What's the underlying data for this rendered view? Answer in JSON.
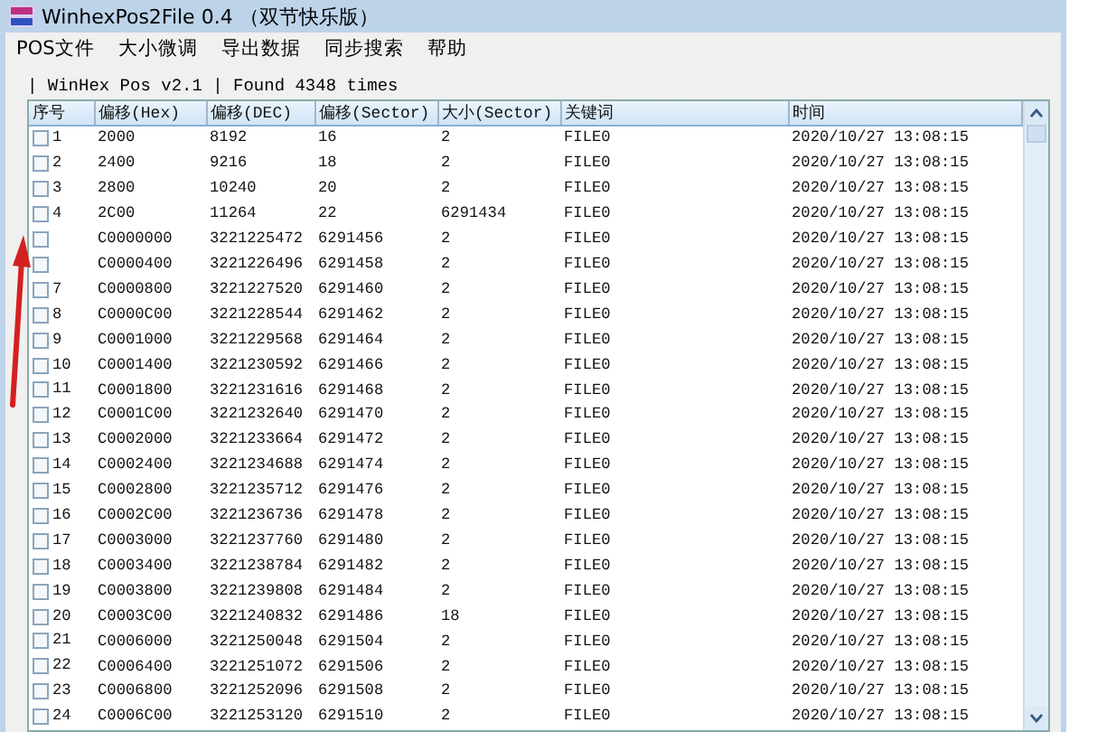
{
  "window": {
    "title": "WinhexPos2File  0.4 （双节快乐版）"
  },
  "menu": [
    "POS文件",
    "大小微调",
    "导出数据",
    "同步搜索",
    "帮助"
  ],
  "group": {
    "title": "| WinHex Pos v2.1 | Found 4348 times"
  },
  "table": {
    "columns": [
      "序号",
      "偏移(Hex)",
      "偏移(DEC)",
      "偏移(Sector)",
      "大小(Sector)",
      "关键词",
      "时间"
    ],
    "rows": [
      {
        "no": "1",
        "checked": false,
        "hex": "2000",
        "dec": "8192",
        "sector": "16",
        "size": "2",
        "keyword": "FILE0",
        "time": "2020/10/27 13:08:15"
      },
      {
        "no": "2",
        "checked": false,
        "hex": "2400",
        "dec": "9216",
        "sector": "18",
        "size": "2",
        "keyword": "FILE0",
        "time": "2020/10/27 13:08:15"
      },
      {
        "no": "3",
        "checked": false,
        "hex": "2800",
        "dec": "10240",
        "sector": "20",
        "size": "2",
        "keyword": "FILE0",
        "time": "2020/10/27 13:08:15"
      },
      {
        "no": "4",
        "checked": false,
        "hex": "2C00",
        "dec": "11264",
        "sector": "22",
        "size": "6291434",
        "keyword": "FILE0",
        "time": "2020/10/27 13:08:15"
      },
      {
        "checked": false,
        "hex": "C0000000",
        "dec": "3221225472",
        "sector": "6291456",
        "size": "2",
        "keyword": "FILE0",
        "time": "2020/10/27 13:08:15"
      },
      {
        "checked": false,
        "hex": "C0000400",
        "dec": "3221226496",
        "sector": "6291458",
        "size": "2",
        "keyword": "FILE0",
        "time": "2020/10/27 13:08:15"
      },
      {
        "no": "7",
        "checked": false,
        "hex": "C0000800",
        "dec": "3221227520",
        "sector": "6291460",
        "size": "2",
        "keyword": "FILE0",
        "time": "2020/10/27 13:08:15"
      },
      {
        "no": "8",
        "checked": false,
        "hex": "C0000C00",
        "dec": "3221228544",
        "sector": "6291462",
        "size": "2",
        "keyword": "FILE0",
        "time": "2020/10/27 13:08:15"
      },
      {
        "no": "9",
        "checked": false,
        "hex": "C0001000",
        "dec": "3221229568",
        "sector": "6291464",
        "size": "2",
        "keyword": "FILE0",
        "time": "2020/10/27 13:08:15"
      },
      {
        "no": "10",
        "checked": false,
        "hex": "C0001400",
        "dec": "3221230592",
        "sector": "6291466",
        "size": "2",
        "keyword": "FILE0",
        "time": "2020/10/27 13:08:15"
      },
      {
        "no": "11",
        "checked": false,
        "hex": "C0001800",
        "dec": "3221231616",
        "sector": "6291468",
        "size": "2",
        "keyword": "FILE0",
        "time": "2020/10/27 13:08:15"
      },
      {
        "no": "12",
        "checked": false,
        "hex": "C0001C00",
        "dec": "3221232640",
        "sector": "6291470",
        "size": "2",
        "keyword": "FILE0",
        "time": "2020/10/27 13:08:15"
      },
      {
        "no": "13",
        "checked": false,
        "hex": "C0002000",
        "dec": "3221233664",
        "sector": "6291472",
        "size": "2",
        "keyword": "FILE0",
        "time": "2020/10/27 13:08:15"
      },
      {
        "no": "14",
        "checked": false,
        "hex": "C0002400",
        "dec": "3221234688",
        "sector": "6291474",
        "size": "2",
        "keyword": "FILE0",
        "time": "2020/10/27 13:08:15"
      },
      {
        "no": "15",
        "checked": false,
        "hex": "C0002800",
        "dec": "3221235712",
        "sector": "6291476",
        "size": "2",
        "keyword": "FILE0",
        "time": "2020/10/27 13:08:15"
      },
      {
        "no": "16",
        "checked": false,
        "hex": "C0002C00",
        "dec": "3221236736",
        "sector": "6291478",
        "size": "2",
        "keyword": "FILE0",
        "time": "2020/10/27 13:08:15"
      },
      {
        "no": "17",
        "checked": false,
        "hex": "C0003000",
        "dec": "3221237760",
        "sector": "6291480",
        "size": "2",
        "keyword": "FILE0",
        "time": "2020/10/27 13:08:15"
      },
      {
        "no": "18",
        "checked": false,
        "hex": "C0003400",
        "dec": "3221238784",
        "sector": "6291482",
        "size": "2",
        "keyword": "FILE0",
        "time": "2020/10/27 13:08:15"
      },
      {
        "no": "19",
        "checked": false,
        "hex": "C0003800",
        "dec": "3221239808",
        "sector": "6291484",
        "size": "2",
        "keyword": "FILE0",
        "time": "2020/10/27 13:08:15"
      },
      {
        "no": "20",
        "checked": false,
        "hex": "C0003C00",
        "dec": "3221240832",
        "sector": "6291486",
        "size": "18",
        "keyword": "FILE0",
        "time": "2020/10/27 13:08:15"
      },
      {
        "no": "21",
        "checked": false,
        "hex": "C0006000",
        "dec": "3221250048",
        "sector": "6291504",
        "size": "2",
        "keyword": "FILE0",
        "time": "2020/10/27 13:08:15"
      },
      {
        "no": "22",
        "checked": false,
        "hex": "C0006400",
        "dec": "3221251072",
        "sector": "6291506",
        "size": "2",
        "keyword": "FILE0",
        "time": "2020/10/27 13:08:15"
      },
      {
        "no": "23",
        "checked": false,
        "hex": "C0006800",
        "dec": "3221252096",
        "sector": "6291508",
        "size": "2",
        "keyword": "FILE0",
        "time": "2020/10/27 13:08:15"
      },
      {
        "no": "24",
        "checked": false,
        "hex": "C0006C00",
        "dec": "3221253120",
        "sector": "6291510",
        "size": "2",
        "keyword": "FILE0",
        "time": "2020/10/27 13:08:15"
      }
    ]
  }
}
